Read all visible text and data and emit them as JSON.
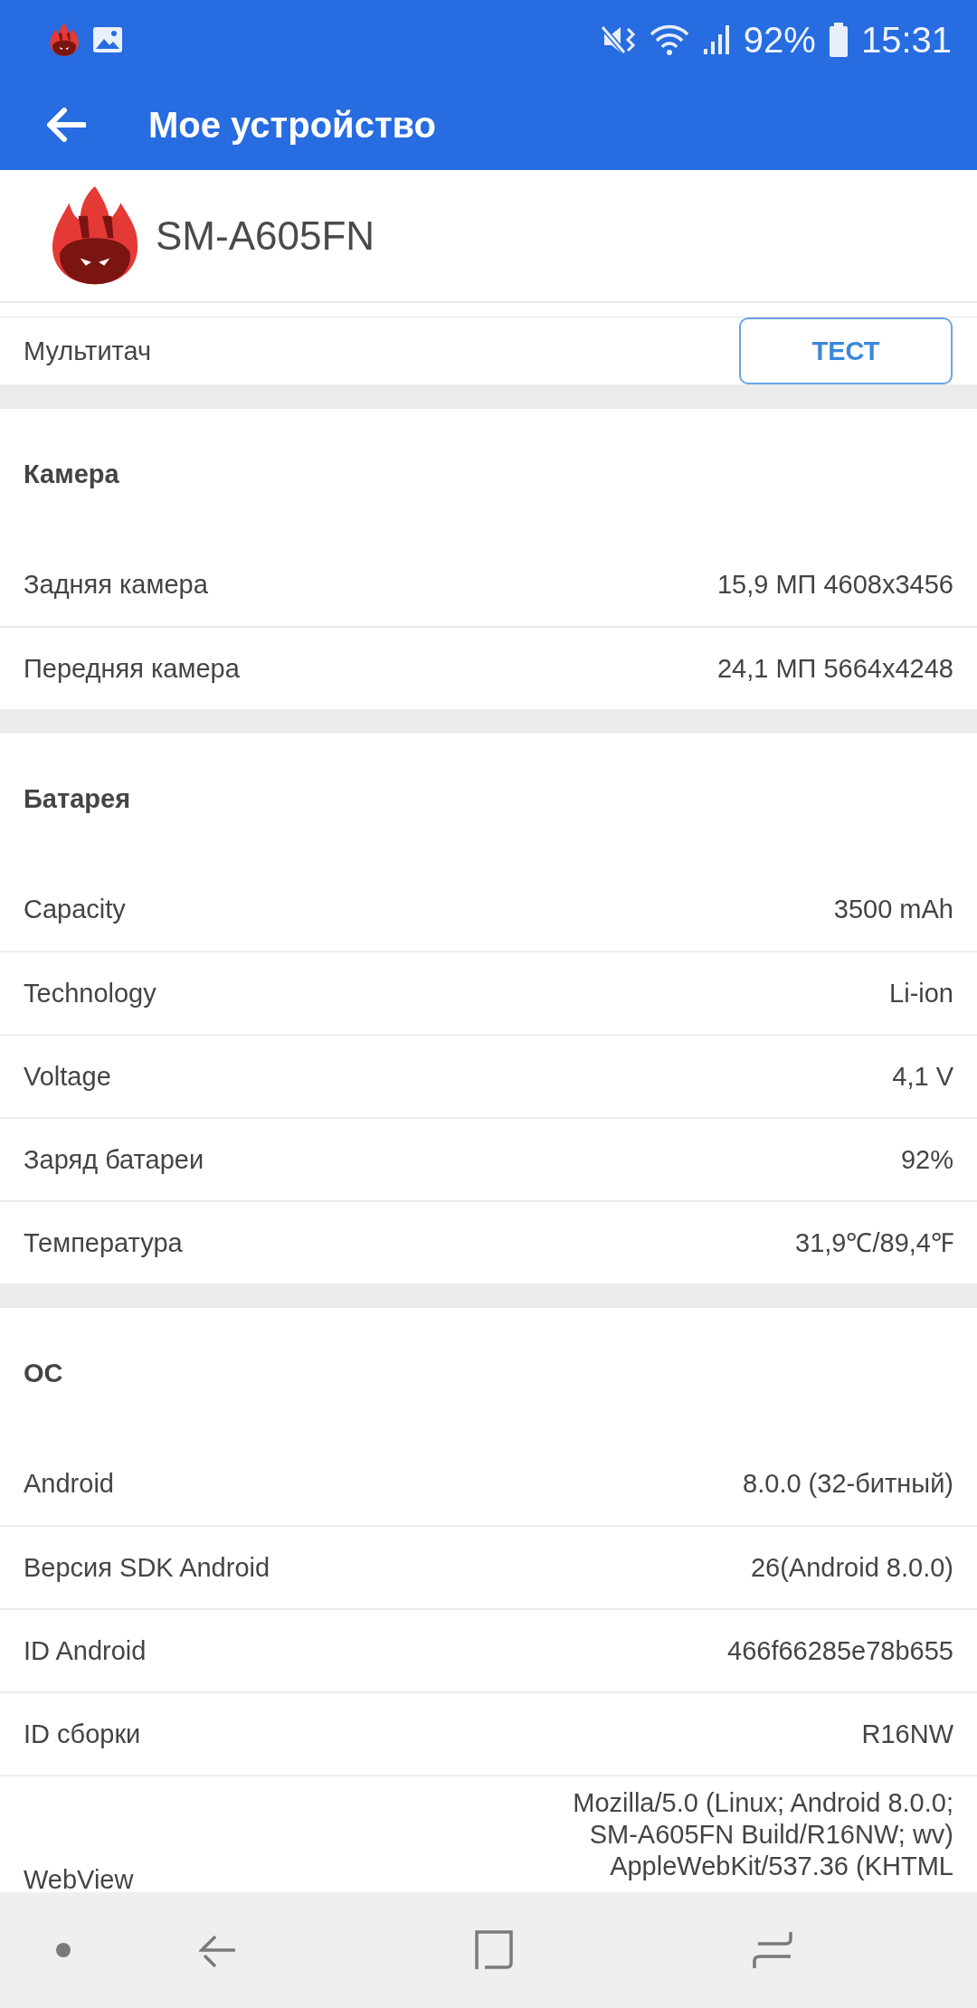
{
  "status_bar": {
    "battery_percent": "92%",
    "time": "15:31"
  },
  "toolbar": {
    "title": "Мое устройство"
  },
  "device": {
    "model": "SM-A605FN"
  },
  "multitouch": {
    "label": "Мультитач",
    "button": "ТЕСТ"
  },
  "sections": [
    {
      "title": "Камера",
      "rows": [
        {
          "label": "Задняя камера",
          "value": "15,9 МП 4608x3456"
        },
        {
          "label": "Передняя камера",
          "value": "24,1 МП 5664x4248"
        }
      ]
    },
    {
      "title": "Батарея",
      "rows": [
        {
          "label": "Capacity",
          "value": "3500 mAh"
        },
        {
          "label": "Technology",
          "value": "Li-ion"
        },
        {
          "label": "Voltage",
          "value": "4,1 V"
        },
        {
          "label": "Заряд батареи",
          "value": "92%"
        },
        {
          "label": "Температура",
          "value": "31,9℃/89,4℉"
        }
      ]
    },
    {
      "title": "ОС",
      "rows": [
        {
          "label": "Android",
          "value": "8.0.0 (32-битный)"
        },
        {
          "label": "Версия SDK Android",
          "value": "26(Android 8.0.0)"
        },
        {
          "label": "ID Android",
          "value": "466f66285e78b655"
        },
        {
          "label": "ID сборки",
          "value": "R16NW"
        },
        {
          "label": "WebView",
          "value": "Mozilla/5.0 (Linux; Android 8.0.0;\nSM-A605FN Build/R16NW; wv)\nAppleWebKit/537.36 (KHTML"
        }
      ]
    }
  ]
}
